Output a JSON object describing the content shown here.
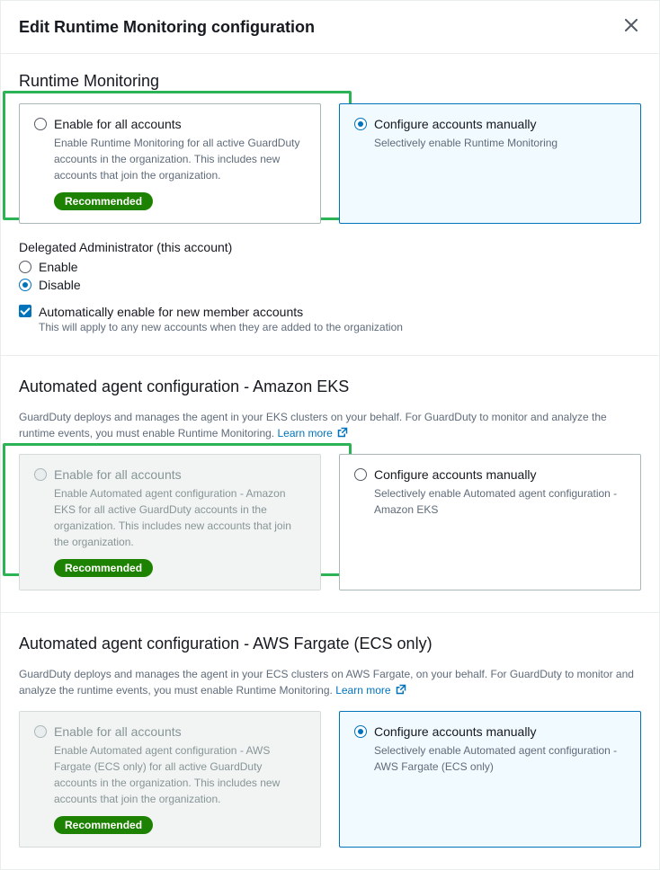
{
  "modal": {
    "title": "Edit Runtime Monitoring configuration"
  },
  "runtime_monitoring": {
    "title": "Runtime Monitoring",
    "enable_all": {
      "label": "Enable for all accounts",
      "desc": "Enable Runtime Monitoring for all active GuardDuty accounts in the organization. This includes new accounts that join the organization.",
      "badge": "Recommended"
    },
    "manual": {
      "label": "Configure accounts manually",
      "desc": "Selectively enable Runtime Monitoring"
    },
    "delegated": {
      "label": "Delegated Administrator (this account)",
      "enable": "Enable",
      "disable": "Disable"
    },
    "auto_new": {
      "label": "Automatically enable for new member accounts",
      "desc": "This will apply to any new accounts when they are added to the organization"
    }
  },
  "eks": {
    "title": "Automated agent configuration - Amazon EKS",
    "desc_pre": "GuardDuty deploys and manages the agent in your EKS clusters on your behalf. For GuardDuty to monitor and analyze the runtime events, you must enable Runtime Monitoring. ",
    "learn_more": "Learn more",
    "enable_all": {
      "label": "Enable for all accounts",
      "desc": "Enable Automated agent configuration - Amazon EKS for all active GuardDuty accounts in the organization. This includes new accounts that join the organization.",
      "badge": "Recommended"
    },
    "manual": {
      "label": "Configure accounts manually",
      "desc": "Selectively enable Automated agent configuration - Amazon EKS"
    }
  },
  "fargate": {
    "title": "Automated agent configuration - AWS Fargate (ECS only)",
    "desc_pre": "GuardDuty deploys and manages the agent in your ECS clusters on AWS Fargate, on your behalf. For GuardDuty to monitor and analyze the runtime events, you must enable Runtime Monitoring. ",
    "learn_more": "Learn more",
    "enable_all": {
      "label": "Enable for all accounts",
      "desc": "Enable Automated agent configuration - AWS Fargate (ECS only) for all active GuardDuty accounts in the organization. This includes new accounts that join the organization.",
      "badge": "Recommended"
    },
    "manual": {
      "label": "Configure accounts manually",
      "desc": "Selectively enable Automated agent configuration - AWS Fargate (ECS only)"
    }
  }
}
